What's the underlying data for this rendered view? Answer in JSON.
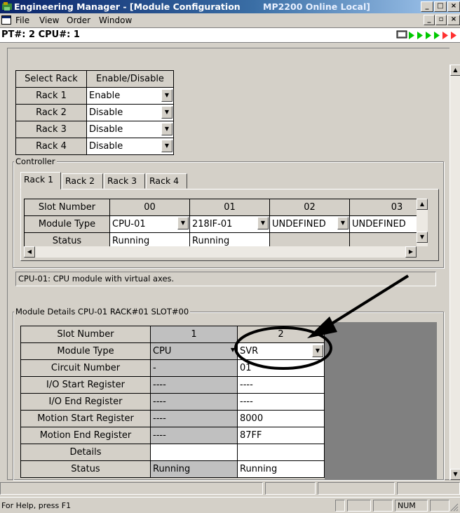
{
  "window": {
    "title": "Engineering Manager - [Module Configuration",
    "status": "MP2200   Online Local]",
    "controls": {
      "minimize": "_",
      "maximize": "□",
      "close": "×"
    },
    "inner_controls": {
      "minimize": "_",
      "restore": "▫",
      "close": "×"
    }
  },
  "menu": {
    "items": [
      "File",
      "View",
      "Order",
      "Window"
    ]
  },
  "pt_bar": {
    "label": "PT#: 2 CPU#: 1"
  },
  "rack_table": {
    "headers": [
      "Select Rack",
      "Enable/Disable"
    ],
    "rows": [
      {
        "rack": "Rack 1",
        "state": "Enable"
      },
      {
        "rack": "Rack 2",
        "state": "Disable"
      },
      {
        "rack": "Rack 3",
        "state": "Disable"
      },
      {
        "rack": "Rack 4",
        "state": "Disable"
      }
    ]
  },
  "controller": {
    "label": "Controller",
    "tabs": [
      "Rack 1",
      "Rack 2",
      "Rack 3",
      "Rack 4"
    ],
    "grid": {
      "row_labels": [
        "Slot Number",
        "Module Type",
        "Status"
      ],
      "slots": [
        "00",
        "01",
        "02",
        "03"
      ],
      "module_types": [
        "CPU-01",
        "218IF-01",
        "UNDEFINED",
        "UNDEFINED"
      ],
      "statuses": [
        "Running",
        "Running",
        "",
        ""
      ]
    },
    "description": "CPU-01: CPU module with virtual axes."
  },
  "module_details": {
    "label": "Module Details  CPU-01  RACK#01  SLOT#00",
    "row_labels": [
      "Slot Number",
      "Module Type",
      "Circuit Number",
      "I/O Start Register",
      "I/O End Register",
      "Motion Start Register",
      "Motion End Register",
      "Details",
      "Status"
    ],
    "col1": [
      "1",
      "CPU",
      "-",
      "----",
      "----",
      "----",
      "----",
      "",
      "Running"
    ],
    "col2": [
      "2",
      "SVR",
      "01",
      "----",
      "----",
      "8000",
      "87FF",
      "",
      "Running"
    ]
  },
  "status_bar": {
    "help": "For Help, press F1",
    "num": "NUM"
  },
  "colors": {
    "title_start": "#0a246a",
    "title_end": "#a6caf0",
    "annotation": "#000000",
    "led_green": "#00c800"
  }
}
